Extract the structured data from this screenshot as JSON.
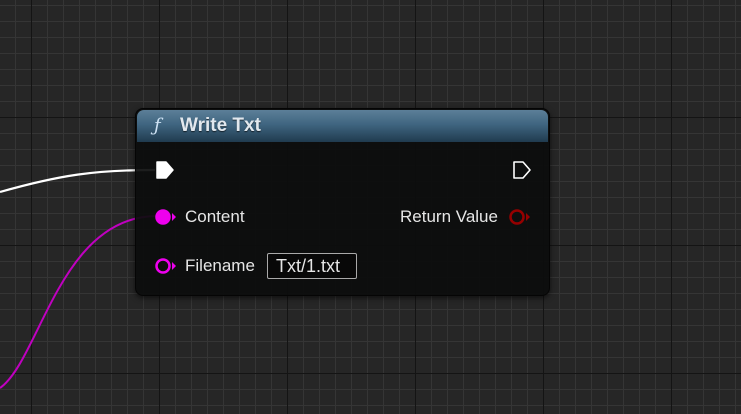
{
  "node": {
    "title": "Write Txt",
    "function_icon": "function-icon",
    "header_color": "#3f6580"
  },
  "pins": {
    "exec_in": {
      "icon": "exec-pin-icon",
      "connected": true
    },
    "exec_out": {
      "icon": "exec-pin-icon",
      "connected": false
    },
    "content": {
      "label": "Content",
      "icon": "string-pin-icon",
      "connected": true,
      "color": "#ee00ee"
    },
    "return_value": {
      "label": "Return Value",
      "icon": "bool-pin-icon",
      "connected": false,
      "color": "#950000"
    },
    "filename": {
      "label": "Filename",
      "icon": "string-pin-icon",
      "connected": false,
      "color": "#ee00ee",
      "value": "Txt/1.txt"
    }
  },
  "wires": {
    "exec_color": "#ffffff",
    "string_color": "#c000c0"
  }
}
